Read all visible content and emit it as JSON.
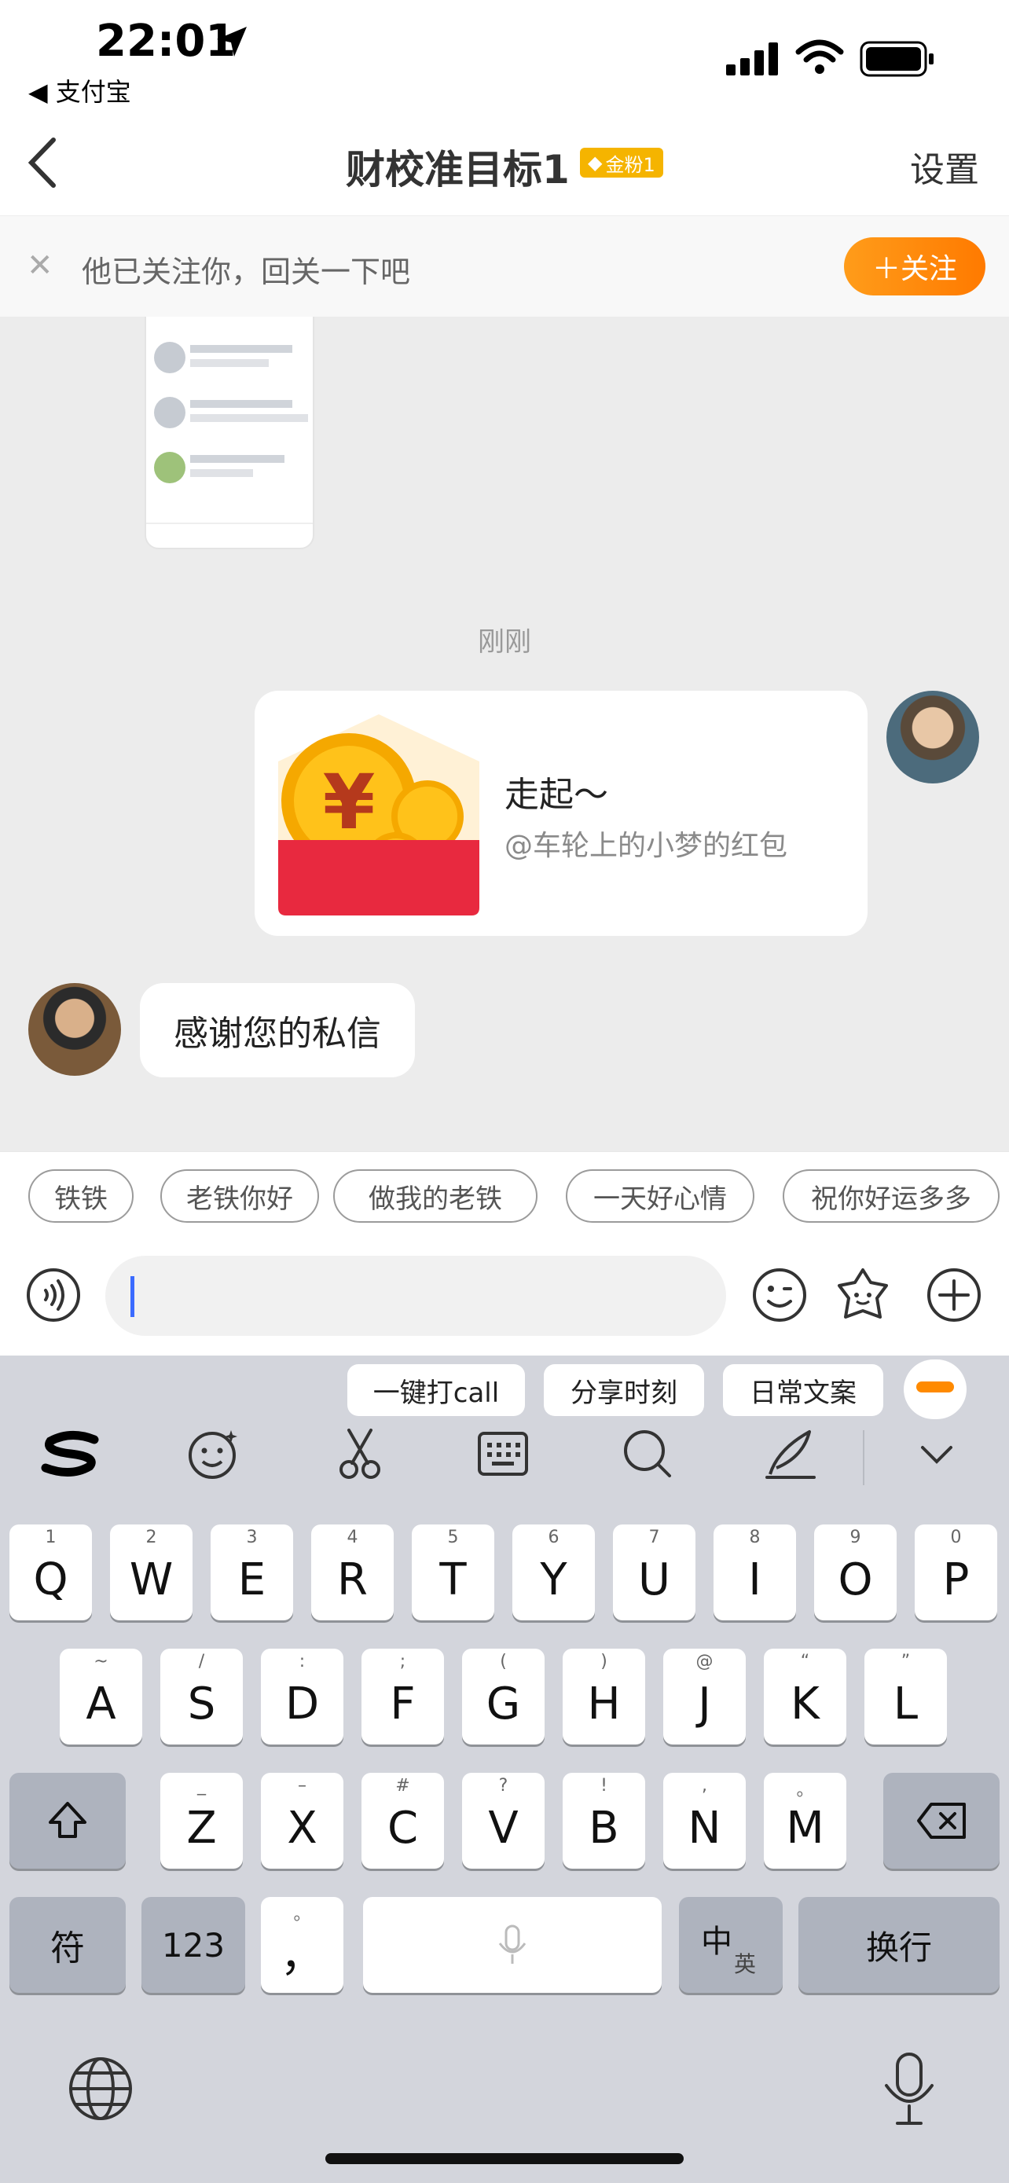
{
  "status_bar": {
    "time": "22:01",
    "back_app": "◀ 支付宝"
  },
  "nav": {
    "title": "财校准目标1",
    "badge": "金粉1",
    "settings": "设置"
  },
  "banner": {
    "text": "他已关注你，回关一下吧",
    "follow_button": "＋关注"
  },
  "chat": {
    "timestamp": "刚刚",
    "red_packet": {
      "title": "走起～",
      "subtitle": "@车轮上的小梦的红包"
    },
    "reply": "感谢您的私信"
  },
  "quick_replies": [
    "铁铁",
    "老铁你好",
    "做我的老铁",
    "一天好心情",
    "祝你好运多多"
  ],
  "input": {
    "placeholder": ""
  },
  "keyboard": {
    "suggestions": [
      "一键打call",
      "分享时刻",
      "日常文案"
    ],
    "row1": [
      {
        "k": "Q",
        "a": "1"
      },
      {
        "k": "W",
        "a": "2"
      },
      {
        "k": "E",
        "a": "3"
      },
      {
        "k": "R",
        "a": "4"
      },
      {
        "k": "T",
        "a": "5"
      },
      {
        "k": "Y",
        "a": "6"
      },
      {
        "k": "U",
        "a": "7"
      },
      {
        "k": "I",
        "a": "8"
      },
      {
        "k": "O",
        "a": "9"
      },
      {
        "k": "P",
        "a": "0"
      }
    ],
    "row2": [
      {
        "k": "A",
        "a": "~"
      },
      {
        "k": "S",
        "a": "/"
      },
      {
        "k": "D",
        "a": ":"
      },
      {
        "k": "F",
        "a": ";"
      },
      {
        "k": "G",
        "a": "("
      },
      {
        "k": "H",
        "a": ")"
      },
      {
        "k": "J",
        "a": "@"
      },
      {
        "k": "K",
        "a": "“"
      },
      {
        "k": "L",
        "a": "”"
      }
    ],
    "row3": [
      {
        "k": "Z",
        "a": "_"
      },
      {
        "k": "X",
        "a": "–"
      },
      {
        "k": "C",
        "a": "#"
      },
      {
        "k": "V",
        "a": "?"
      },
      {
        "k": "B",
        "a": "!"
      },
      {
        "k": "N",
        "a": ","
      },
      {
        "k": "M",
        "a": "。"
      }
    ],
    "symbols_key": "符",
    "numbers_key": "123",
    "punct_key": "，",
    "punct_alt": "。",
    "lang_key": "中",
    "lang_alt": "英",
    "return_key": "换行"
  },
  "colors": {
    "accent": "#ff8a00",
    "badge": "#f5b400",
    "packet_red": "#e8293f"
  }
}
